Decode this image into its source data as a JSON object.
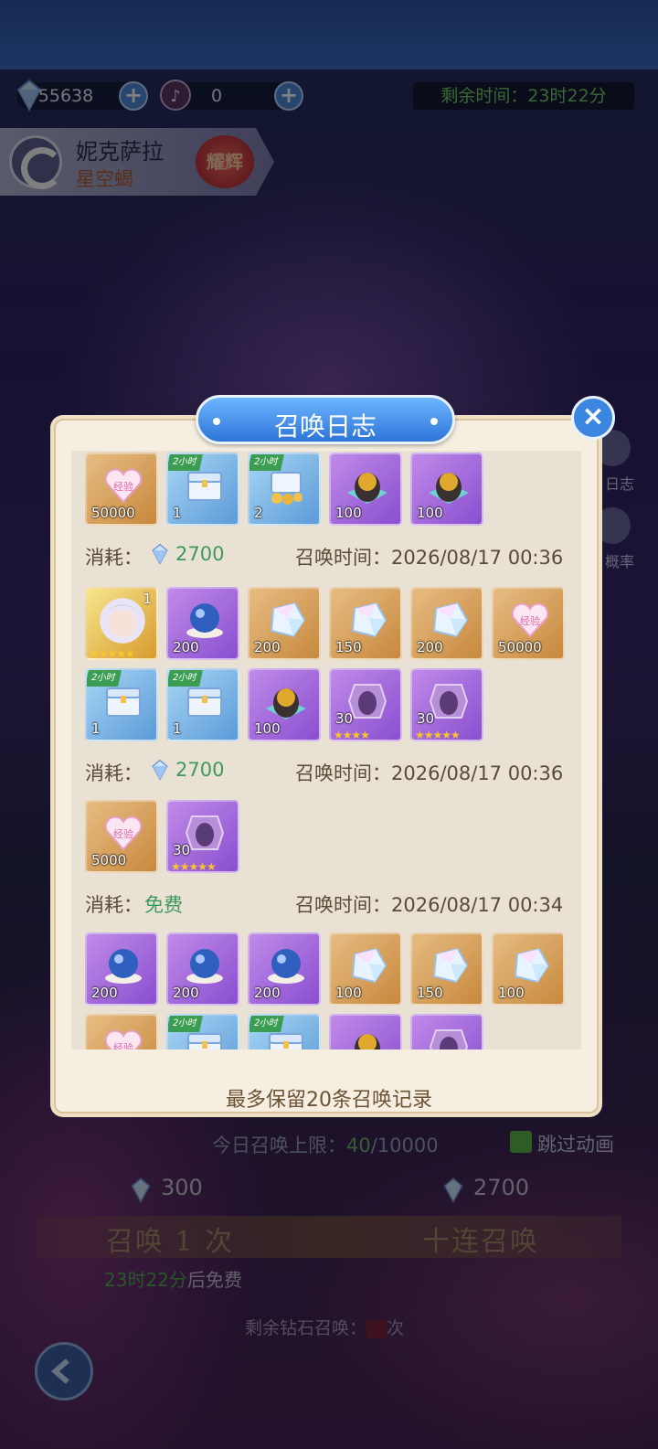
{
  "resources": {
    "diamonds": "55638",
    "tickets": "0"
  },
  "timer": "剩余时间：23时22分",
  "hero": {
    "name": "妮克萨拉",
    "title": "星空蝎",
    "badge": "耀辉"
  },
  "side": {
    "log": "日志",
    "rate": "概率"
  },
  "bottom": {
    "limit_label": "今日召唤上限：",
    "limit_used": "40",
    "limit_total": "/10000",
    "skip": "跳过动画",
    "single_cost": "300",
    "ten_cost": "2700",
    "single_btn": "召唤 1 次",
    "ten_btn": "十连召唤",
    "free_time": "23时22分",
    "free_suffix": "后免费",
    "remaining": "剩余钻石召唤：",
    "remaining_unit": "次"
  },
  "modal": {
    "title": "召唤日志",
    "footer": "最多保留20条召唤记录",
    "cost_label": "消耗：",
    "time_label": "召唤时间：",
    "records": [
      {
        "cost": "2700",
        "time": "2026/08/17 00:36",
        "items": [
          {
            "kind": "exp",
            "count": "50000"
          },
          {
            "kind": "chest",
            "count": "1",
            "tag": "2小时"
          },
          {
            "kind": "coin-chest",
            "count": "2",
            "tag": "2小时"
          },
          {
            "kind": "egg",
            "count": "100"
          },
          {
            "kind": "egg",
            "count": "100"
          }
        ]
      },
      {
        "cost": "2700",
        "time": "2026/08/17 00:36",
        "items": [
          {
            "kind": "hero",
            "count": "1",
            "stars": "★★★★★"
          },
          {
            "kind": "orb",
            "count": "200"
          },
          {
            "kind": "crystal",
            "count": "200"
          },
          {
            "kind": "crystal",
            "count": "150"
          },
          {
            "kind": "crystal",
            "count": "200"
          },
          {
            "kind": "exp",
            "count": "50000"
          },
          {
            "kind": "chest",
            "count": "1",
            "tag": "2小时"
          },
          {
            "kind": "chest",
            "count": "1",
            "tag": "2小时"
          },
          {
            "kind": "egg",
            "count": "100"
          },
          {
            "kind": "shard",
            "count": "30",
            "stars": "★★★★"
          },
          {
            "kind": "shard",
            "count": "30",
            "stars": "★★★★★"
          }
        ]
      },
      {
        "cost": "免费",
        "time": "2026/08/17 00:34",
        "items": [
          {
            "kind": "exp",
            "count": "5000"
          },
          {
            "kind": "shard",
            "count": "30",
            "stars": "★★★★★"
          }
        ]
      },
      {
        "cost": "",
        "time": "",
        "items": [
          {
            "kind": "orb",
            "count": "200"
          },
          {
            "kind": "orb",
            "count": "200"
          },
          {
            "kind": "orb",
            "count": "200"
          },
          {
            "kind": "crystal",
            "count": "100"
          },
          {
            "kind": "crystal",
            "count": "150"
          },
          {
            "kind": "crystal",
            "count": "100"
          },
          {
            "kind": "exp",
            "count": ""
          },
          {
            "kind": "chest",
            "count": "",
            "tag": "2小时"
          },
          {
            "kind": "chest",
            "count": "",
            "tag": "2小时"
          },
          {
            "kind": "egg",
            "count": ""
          },
          {
            "kind": "shard",
            "count": ""
          }
        ]
      }
    ]
  },
  "icons": {
    "diamond": "diamond-icon",
    "ticket": "music-ticket-icon",
    "close": "close-icon",
    "back": "back-arrow-icon",
    "check": "checkmark-icon"
  },
  "colors": {
    "accent": "#3b86e0",
    "free": "#3e9a5c",
    "panel": "#f6efe1"
  }
}
